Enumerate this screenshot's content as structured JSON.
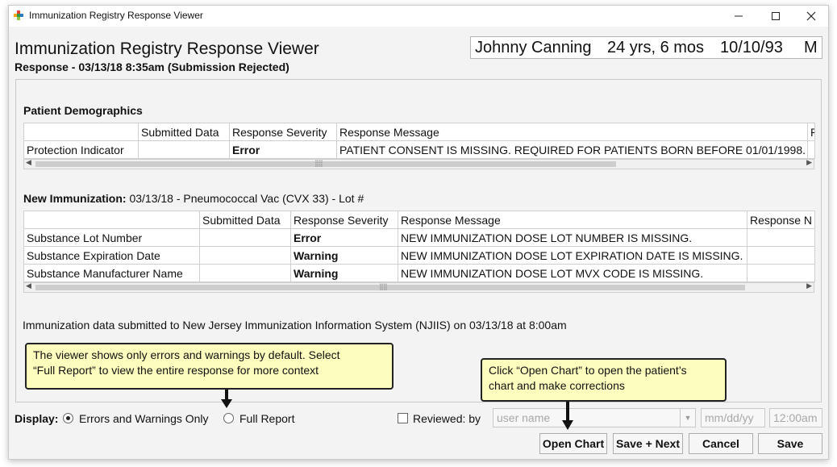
{
  "window": {
    "title": "Immunization Registry Response Viewer"
  },
  "header": {
    "title": "Immunization Registry Response Viewer",
    "subtitle": "Response - 03/13/18 8:35am (Submission Rejected)"
  },
  "patient": {
    "name": "Johnny Canning",
    "age": "24 yrs, 6 mos",
    "dob": "10/10/93",
    "sex": "M"
  },
  "demographics": {
    "title": "Patient Demographics",
    "columns": [
      "",
      "Submitted Data",
      "Response Severity",
      "Response Message",
      "R"
    ],
    "rows": [
      [
        "Protection Indicator",
        "",
        "Error",
        "PATIENT CONSENT IS MISSING. REQUIRED FOR PATIENTS BORN BEFORE 01/01/1998.",
        ""
      ]
    ]
  },
  "immunization": {
    "title_bold": "New Immunization:",
    "title_rest": " 03/13/18 - Pneumococcal Vac (CVX 33) - Lot #",
    "columns": [
      "",
      "Submitted Data",
      "Response Severity",
      "Response Message",
      "Response N"
    ],
    "rows": [
      [
        "Substance Lot Number",
        "",
        "Error",
        "NEW IMMUNIZATION DOSE LOT NUMBER IS MISSING.",
        ""
      ],
      [
        "Substance Expiration Date",
        "",
        "Warning",
        "NEW IMMUNIZATION DOSE LOT EXPIRATION DATE IS MISSING.",
        ""
      ],
      [
        "Substance Manufacturer Name",
        "",
        "Warning",
        "NEW IMMUNIZATION DOSE LOT MVX CODE IS MISSING.",
        ""
      ]
    ]
  },
  "submitted_note": "Immunization data submitted to New Jersey Immunization Information System (NJIIS) on 03/13/18 at 8:00am",
  "callouts": {
    "left_line1": "The viewer shows only errors and warnings by default. Select",
    "left_line2": "“Full Report” to view the entire response for more context",
    "right_line1": "Click “Open Chart” to open the patient’s",
    "right_line2": "chart and make corrections"
  },
  "display": {
    "label": "Display:",
    "option_errors": "Errors and Warnings Only",
    "option_full": "Full Report",
    "selected": "Errors and Warnings Only"
  },
  "review": {
    "label": "Reviewed: by",
    "user_placeholder": "user name",
    "date_placeholder": "mm/dd/yy",
    "time_placeholder": "12:00am"
  },
  "buttons": {
    "open_chart": "Open Chart",
    "save_next": "Save + Next",
    "cancel": "Cancel",
    "save": "Save"
  },
  "colors": {
    "callout_bg": "#fdfdbe",
    "window_bg": "#f3f3f3"
  }
}
